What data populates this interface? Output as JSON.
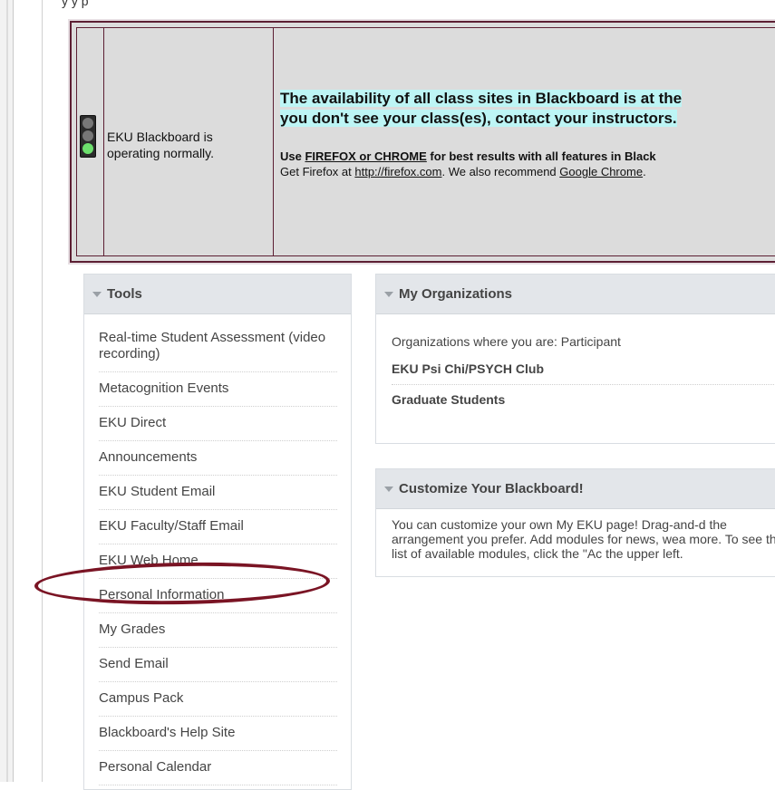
{
  "top_text": "y      y  p",
  "banner": {
    "status_text": "EKU Blackboard is operating normally.",
    "headline_line1": "The availability of all class sites in Blackboard is at the",
    "headline_line2": "you don't see your class(es), contact your instructors.",
    "note_prefix": "Use ",
    "note_browsers": "FIREFOX or CHROME",
    "note_suffix": " for best results with all features in Black",
    "note_line2_prefix": "Get Firefox at ",
    "firefox_link": "http://firefox.com",
    "note_line2_mid": ". We also recommend ",
    "chrome_link": "Google Chrome",
    "note_line2_end": "."
  },
  "tools": {
    "title": "Tools",
    "items": [
      "Real-time Student Assessment (video recording)",
      "Metacognition Events",
      "EKU Direct",
      "Announcements",
      "EKU Student Email",
      "EKU Faculty/Staff Email",
      "EKU Web Home",
      "Personal Information",
      "My Grades",
      "Send Email",
      "Campus Pack",
      "Blackboard's Help Site",
      "Personal Calendar"
    ]
  },
  "organizations": {
    "title": "My Organizations",
    "intro": "Organizations where you are: Participant",
    "items": [
      "EKU Psi Chi/PSYCH Club",
      "Graduate Students"
    ]
  },
  "customize": {
    "title": "Customize Your Blackboard!",
    "body": "You can customize your own My EKU page! Drag-and-d the arrangement you prefer. Add modules for news, wea more. To see the list of available modules, click the \"Ac the upper left."
  },
  "colors": {
    "banner_border": "#5c1f33",
    "highlight": "#bdf5f5",
    "annotation": "#7a1424",
    "module_header": "#e3e6ea"
  }
}
